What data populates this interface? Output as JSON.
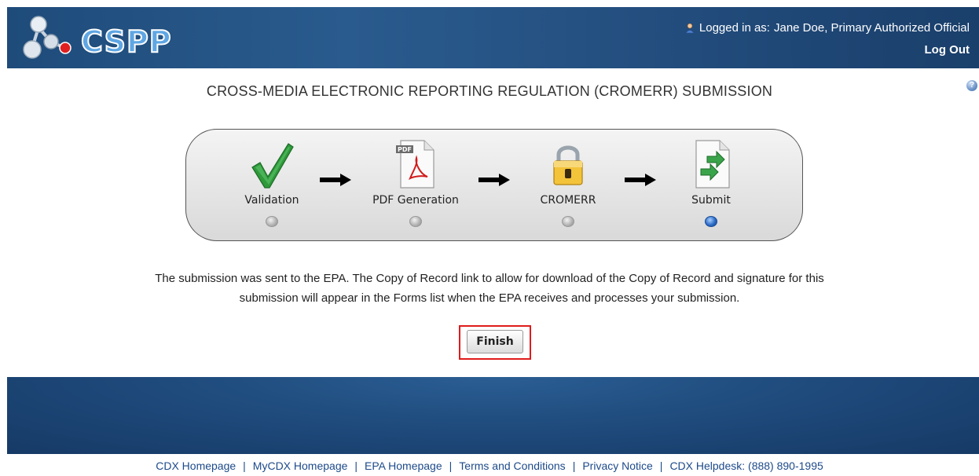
{
  "header": {
    "logo_text": "CSPP",
    "login_prefix": "Logged in as:",
    "user": "Jane Doe, Primary Authorized Official",
    "logout_label": "Log Out"
  },
  "page": {
    "title": "CROSS-MEDIA ELECTRONIC REPORTING REGULATION (CROMERR) SUBMISSION",
    "message_line1": "The submission was sent to the EPA. The Copy of Record link to allow for download of the Copy of Record and signature for this",
    "message_line2": "submission will appear in the Forms list when the EPA receives and processes your submission.",
    "finish_label": "Finish"
  },
  "steps": [
    {
      "label": "Validation",
      "icon": "checkmark-icon",
      "active": false
    },
    {
      "label": "PDF Generation",
      "icon": "pdf-document-icon",
      "active": false
    },
    {
      "label": "CROMERR",
      "icon": "padlock-icon",
      "active": false
    },
    {
      "label": "Submit",
      "icon": "submit-document-icon",
      "active": true
    }
  ],
  "footer": {
    "links": [
      "CDX Homepage",
      "MyCDX Homepage",
      "EPA Homepage",
      "Terms and Conditions",
      "Privacy Notice",
      "CDX Helpdesk: (888) 890-1995"
    ],
    "separator": "|"
  },
  "colors": {
    "header_blue": "#2a5b8e",
    "highlight_red": "#e01b1b",
    "active_step_blue": "#2c6cc6",
    "link_blue": "#1d4a8a"
  }
}
